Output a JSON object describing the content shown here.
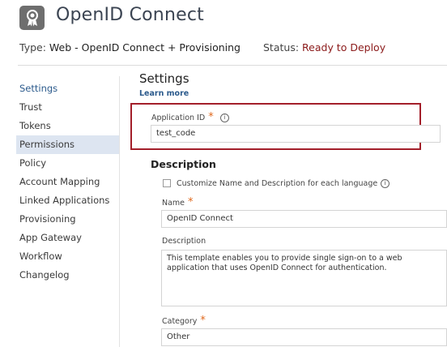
{
  "header": {
    "app_icon": "ribbon-badge-icon",
    "title": "OpenID Connect",
    "type_label": "Type:",
    "type_value": "Web - OpenID Connect + Provisioning",
    "status_label": "Status:",
    "status_value": "Ready to Deploy"
  },
  "colors": {
    "status": "#8b1a1a",
    "required": "#e06a1f",
    "highlight_border": "#a31f2a",
    "active_bg": "#dde5f1",
    "link": "#2b5a8c"
  },
  "sidebar": {
    "items": [
      {
        "label": "Settings"
      },
      {
        "label": "Trust"
      },
      {
        "label": "Tokens"
      },
      {
        "label": "Permissions"
      },
      {
        "label": "Policy"
      },
      {
        "label": "Account Mapping"
      },
      {
        "label": "Linked Applications"
      },
      {
        "label": "Provisioning"
      },
      {
        "label": "App Gateway"
      },
      {
        "label": "Workflow"
      },
      {
        "label": "Changelog"
      }
    ]
  },
  "main": {
    "heading": "Settings",
    "learn_more": "Learn more",
    "application_id": {
      "label": "Application ID",
      "required_mark": "*",
      "info_icon": "ⓘ",
      "value": "test_code"
    },
    "description_section": {
      "heading": "Description",
      "customize_label": "Customize Name and Description for each language",
      "info_icon": "ⓘ",
      "name_label": "Name",
      "name_required": "*",
      "name_value": "OpenID Connect",
      "description_label": "Description",
      "description_value": "This template enables you to provide single sign-on to a web application that uses OpenID Connect for authentication.",
      "category_label": "Category",
      "category_required": "*",
      "category_value": "Other"
    }
  }
}
